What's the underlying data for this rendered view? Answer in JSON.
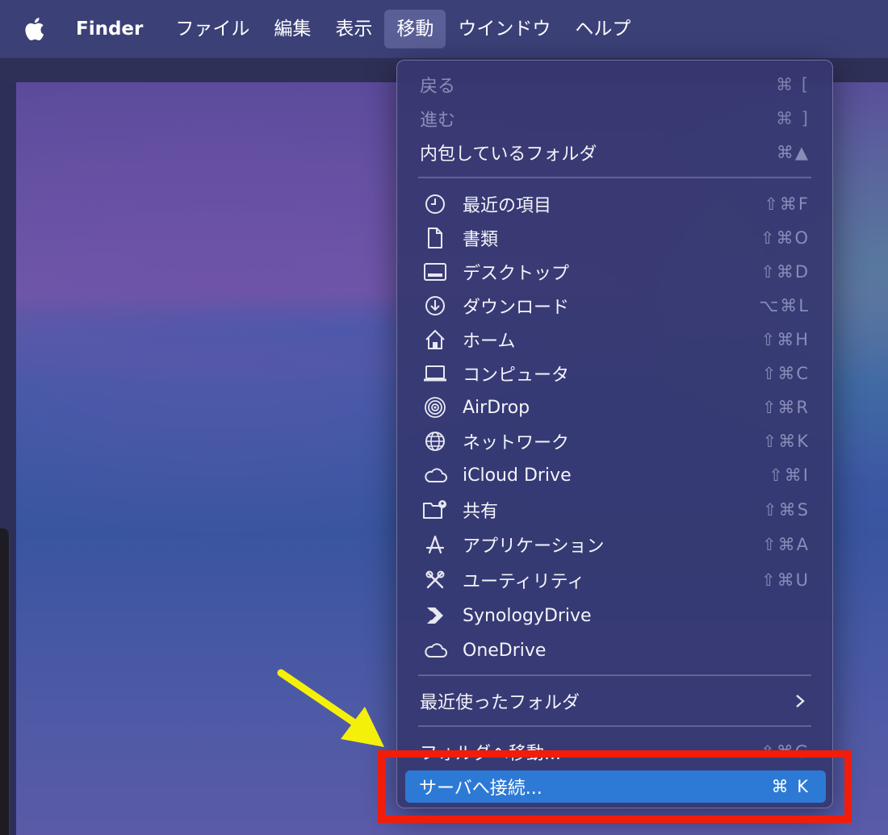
{
  "menubar": {
    "apple_icon": "apple-logo-icon",
    "items": [
      {
        "label": "Finder"
      },
      {
        "label": "ファイル"
      },
      {
        "label": "編集"
      },
      {
        "label": "表示"
      },
      {
        "label": "移動"
      },
      {
        "label": "ウインドウ"
      },
      {
        "label": "ヘルプ"
      }
    ],
    "active_item": "移動"
  },
  "go_menu": {
    "items": [
      {
        "label": "戻る",
        "shortcut": "⌘ [",
        "disabled": true
      },
      {
        "label": "進む",
        "shortcut": "⌘ ]",
        "disabled": true
      },
      {
        "label": "内包しているフォルダ",
        "shortcut": "⌘▲"
      },
      {
        "label": "最近の項目",
        "shortcut": "⇧⌘F",
        "icon": "clock-icon"
      },
      {
        "label": "書類",
        "shortcut": "⇧⌘O",
        "icon": "document-icon"
      },
      {
        "label": "デスクトップ",
        "shortcut": "⇧⌘D",
        "icon": "desktop-icon"
      },
      {
        "label": "ダウンロード",
        "shortcut": "⌥⌘L",
        "icon": "download-icon"
      },
      {
        "label": "ホーム",
        "shortcut": "⇧⌘H",
        "icon": "home-icon"
      },
      {
        "label": "コンピュータ",
        "shortcut": "⇧⌘C",
        "icon": "laptop-icon"
      },
      {
        "label": "AirDrop",
        "shortcut": "⇧⌘R",
        "icon": "airdrop-icon"
      },
      {
        "label": "ネットワーク",
        "shortcut": "⇧⌘K",
        "icon": "globe-icon"
      },
      {
        "label": "iCloud Drive",
        "shortcut": "⇧⌘I",
        "icon": "cloud-icon"
      },
      {
        "label": "共有",
        "shortcut": "⇧⌘S",
        "icon": "shared-folder-icon"
      },
      {
        "label": "アプリケーション",
        "shortcut": "⇧⌘A",
        "icon": "applications-icon"
      },
      {
        "label": "ユーティリティ",
        "shortcut": "⇧⌘U",
        "icon": "utilities-icon"
      },
      {
        "label": "SynologyDrive",
        "shortcut": "",
        "icon": "synology-drive-icon"
      },
      {
        "label": "OneDrive",
        "shortcut": "",
        "icon": "cloud-icon"
      },
      {
        "label": "最近使ったフォルダ",
        "shortcut": "",
        "has_submenu": true
      },
      {
        "label": "フォルダへ移動...",
        "shortcut": "⇧⌘G"
      },
      {
        "label": "サーバへ接続...",
        "shortcut": "⌘ K",
        "highlighted": true
      }
    ]
  },
  "annotations": {
    "arrow_color": "#f5f00a",
    "box_color": "#f11d0a"
  },
  "colors": {
    "menubar_bg": "#3b4077",
    "highlight_bg": "#2d7ad6"
  }
}
